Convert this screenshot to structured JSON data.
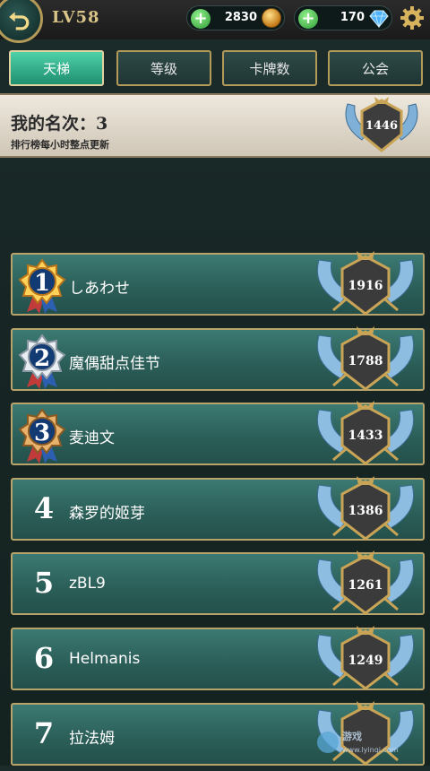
{
  "header": {
    "level": "LV58",
    "gold": "2830",
    "gems": "170",
    "icons": [
      "back-icon",
      "plus-icon",
      "coin-icon",
      "diamond-icon",
      "gear-icon"
    ]
  },
  "tabs": [
    {
      "label": "天梯",
      "active": true
    },
    {
      "label": "等级",
      "active": false
    },
    {
      "label": "卡牌数",
      "active": false
    },
    {
      "label": "公会",
      "active": false
    }
  ],
  "my_rank": {
    "title": "我的名次：3",
    "subtitle": "排行榜每小时整点更新",
    "score": "1446"
  },
  "ranking": [
    {
      "rank": "1",
      "name": "しあわせ",
      "score": "1916",
      "medal": "gold"
    },
    {
      "rank": "2",
      "name": "魔偶甜点佳节",
      "score": "1788",
      "medal": "silver"
    },
    {
      "rank": "3",
      "name": "麦迪文",
      "score": "1433",
      "medal": "bronze"
    },
    {
      "rank": "4",
      "name": "森罗的姬芽",
      "score": "1386",
      "medal": ""
    },
    {
      "rank": "5",
      "name": "zBL9",
      "score": "1261",
      "medal": ""
    },
    {
      "rank": "6",
      "name": "Helmanis",
      "score": "1249",
      "medal": ""
    },
    {
      "rank": "7",
      "name": "拉法姆",
      "score": "",
      "medal": ""
    }
  ],
  "watermark": "www.lyinqi.com",
  "colors": {
    "accent_gold": "#b49a58",
    "tab_active": "#2fb48c",
    "row_teal": "#2c5f59"
  }
}
